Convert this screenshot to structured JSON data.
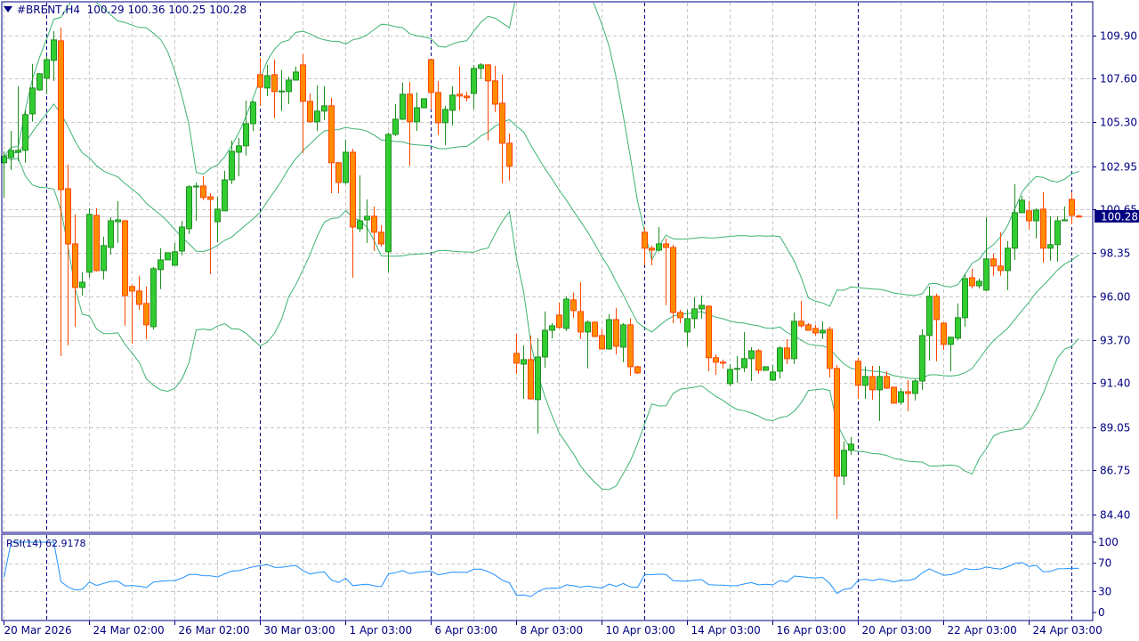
{
  "header": {
    "symbol": "#BRENT,H4",
    "open": "100.29",
    "high": "100.36",
    "low": "100.25",
    "close": "100.28"
  },
  "rsi_label": {
    "name": "RSI(14)",
    "value": "62.9178"
  },
  "current_price_label": "100.28",
  "colors": {
    "bull": "#32CD32",
    "bull_border": "#1F8F1F",
    "bear": "#FF8C00",
    "bear_border": "#FF4500",
    "bands": "#3CB371",
    "rsi": "#1E90FF",
    "axis": "#000080",
    "grid": "#C8C8C8"
  },
  "chart_data": [
    {
      "type": "candlestick",
      "title": "#BRENT,H4",
      "indicators": [
        "Bollinger Bands (20, 2)"
      ],
      "ylim": [
        83.45,
        111.7
      ],
      "y_ticks": [
        "109.90",
        "107.60",
        "105.30",
        "102.95",
        "100.65",
        "98.35",
        "96.00",
        "93.70",
        "91.40",
        "89.05",
        "86.75",
        "84.40"
      ],
      "x_ticks": [
        {
          "index": 0,
          "label": "20 Mar 2026"
        },
        {
          "index": 12,
          "label": "24 Mar 02:00"
        },
        {
          "index": 24,
          "label": "26 Mar 02:00"
        },
        {
          "index": 36,
          "label": "30 Mar 03:00"
        },
        {
          "index": 48,
          "label": "1 Apr 03:00"
        },
        {
          "index": 60,
          "label": "6 Apr 03:00"
        },
        {
          "index": 72,
          "label": "8 Apr 03:00"
        },
        {
          "index": 84,
          "label": "10 Apr 03:00"
        },
        {
          "index": 96,
          "label": "14 Apr 03:00"
        },
        {
          "index": 108,
          "label": "16 Apr 03:00"
        },
        {
          "index": 120,
          "label": "20 Apr 03:00"
        },
        {
          "index": 132,
          "label": "22 Apr 03:00"
        },
        {
          "index": 144,
          "label": "24 Apr 03:00"
        }
      ],
      "period_separators": [
        6,
        36,
        60,
        90,
        120,
        150
      ],
      "current_price": 100.28,
      "ohlc": [
        [
          103.13,
          103.74,
          101.28,
          103.46
        ],
        [
          103.41,
          104.83,
          102.75,
          103.79
        ],
        [
          103.69,
          107.2,
          103.22,
          103.79
        ],
        [
          103.79,
          105.92,
          103.13,
          105.69
        ],
        [
          105.73,
          108.39,
          105.31,
          107.11
        ],
        [
          107.01,
          107.91,
          106.97,
          107.87
        ],
        [
          107.63,
          108.81,
          106.78,
          108.62
        ],
        [
          108.58,
          110.14,
          107.49,
          109.67
        ],
        [
          109.62,
          110.33,
          92.84,
          101.7
        ],
        [
          101.75,
          103.03,
          93.41,
          98.81
        ],
        [
          98.81,
          100.38,
          94.4,
          96.49
        ],
        [
          96.49,
          97.3,
          96.06,
          96.77
        ],
        [
          97.3,
          100.71,
          97.01,
          100.38
        ],
        [
          100.33,
          100.71,
          97.34,
          97.39
        ],
        [
          97.39,
          99.19,
          96.92,
          98.72
        ],
        [
          98.62,
          100.23,
          98.24,
          100.04
        ],
        [
          99.99,
          101.09,
          98.86,
          100.09
        ],
        [
          100.04,
          100.09,
          94.45,
          96.06
        ],
        [
          96.54,
          96.63,
          93.5,
          96.3
        ],
        [
          96.3,
          97.11,
          95.3,
          95.59
        ],
        [
          95.64,
          96.54,
          93.74,
          94.5
        ],
        [
          94.4,
          97.58,
          94.26,
          97.49
        ],
        [
          97.44,
          98.58,
          96.4,
          97.96
        ],
        [
          97.96,
          98.34,
          97.96,
          98.34
        ],
        [
          97.67,
          98.86,
          97.67,
          98.39
        ],
        [
          98.43,
          100.04,
          98.2,
          99.71
        ],
        [
          99.62,
          101.94,
          99.33,
          101.85
        ],
        [
          101.85,
          102.08,
          100.04,
          101.89
        ],
        [
          101.89,
          102.41,
          101.14,
          101.28
        ],
        [
          101.32,
          101.51,
          97.2,
          101.18
        ],
        [
          99.99,
          101.32,
          98.91,
          100.66
        ],
        [
          100.57,
          102.7,
          100.57,
          102.22
        ],
        [
          102.22,
          104.31,
          101.99,
          103.74
        ],
        [
          103.69,
          104.45,
          102.41,
          104.03
        ],
        [
          104.03,
          106.44,
          103.51,
          105.21
        ],
        [
          105.21,
          106.44,
          104.83,
          106.35
        ],
        [
          107.82,
          108.72,
          106.16,
          107.15
        ],
        [
          107.11,
          108.34,
          106.68,
          107.77
        ],
        [
          107.82,
          108.62,
          105.5,
          106.92
        ],
        [
          106.92,
          108.06,
          105.88,
          106.95
        ],
        [
          106.92,
          107.72,
          106.25,
          107.53
        ],
        [
          107.53,
          108.25,
          107.53,
          107.96
        ],
        [
          108.34,
          108.91,
          103.65,
          106.4
        ],
        [
          106.4,
          106.82,
          105.31,
          105.31
        ],
        [
          105.31,
          107.25,
          104.83,
          105.88
        ],
        [
          105.88,
          107.2,
          105.4,
          106.16
        ],
        [
          106.16,
          106.59,
          101.51,
          103.13
        ],
        [
          103.13,
          103.17,
          101.51,
          102.08
        ],
        [
          102.08,
          104.36,
          101.99,
          103.69
        ],
        [
          103.69,
          103.88,
          97.01,
          99.71
        ],
        [
          99.62,
          102.46,
          99.43,
          100.04
        ],
        [
          100.09,
          101.18,
          98.86,
          100.28
        ],
        [
          100.28,
          100.8,
          98.43,
          99.43
        ],
        [
          99.43,
          99.81,
          98.67,
          98.81
        ],
        [
          98.39,
          104.74,
          97.3,
          104.64
        ],
        [
          104.64,
          106.25,
          104.55,
          105.45
        ],
        [
          105.45,
          107.39,
          105.4,
          106.78
        ],
        [
          106.78,
          107.44,
          102.98,
          105.31
        ],
        [
          105.31,
          106.87,
          104.83,
          106.06
        ],
        [
          106.06,
          106.54,
          106.06,
          106.54
        ],
        [
          108.62,
          108.62,
          105.97,
          106.87
        ],
        [
          106.87,
          107.49,
          104.6,
          105.26
        ],
        [
          105.26,
          106.16,
          104.07,
          105.97
        ],
        [
          105.92,
          107.2,
          105.12,
          106.73
        ],
        [
          106.78,
          108.25,
          105.92,
          106.68
        ],
        [
          106.68,
          106.92,
          106.4,
          106.59
        ],
        [
          106.82,
          108.34,
          105.97,
          108.15
        ],
        [
          108.15,
          108.43,
          107.58,
          108.34
        ],
        [
          108.34,
          108.39,
          104.31,
          107.49
        ],
        [
          107.49,
          108.29,
          105.83,
          106.25
        ],
        [
          106.3,
          107.82,
          102.04,
          104.17
        ],
        [
          104.17,
          104.69,
          102.18,
          102.94
        ],
        [
          92.98,
          94.03,
          91.89,
          92.46
        ],
        [
          92.41,
          93.41,
          90.56,
          92.65
        ],
        [
          92.65,
          93.93,
          90.52,
          90.56
        ],
        [
          90.52,
          93.79,
          88.72,
          92.79
        ],
        [
          92.79,
          95.21,
          92.22,
          94.21
        ],
        [
          94.21,
          94.59,
          93.79,
          94.45
        ],
        [
          95.02,
          95.68,
          94.31,
          94.36
        ],
        [
          94.31,
          96.02,
          94.17,
          95.87
        ],
        [
          95.83,
          96.21,
          94.88,
          95.26
        ],
        [
          95.21,
          96.77,
          93.74,
          94.12
        ],
        [
          94.12,
          94.74,
          92.18,
          94.64
        ],
        [
          94.64,
          94.69,
          93.84,
          93.88
        ],
        [
          93.93,
          94.26,
          93.17,
          93.22
        ],
        [
          93.22,
          95.07,
          93.17,
          94.78
        ],
        [
          94.78,
          95.4,
          92.93,
          93.36
        ],
        [
          93.31,
          94.59,
          92.51,
          94.5
        ],
        [
          94.5,
          94.83,
          91.8,
          92.27
        ],
        [
          92.27,
          92.32,
          91.89,
          91.94
        ],
        [
          99.43,
          99.71,
          97.67,
          98.58
        ],
        [
          98.58,
          98.72,
          97.67,
          98.48
        ],
        [
          98.48,
          99.71,
          98.39,
          98.81
        ],
        [
          98.81,
          99.1,
          95.54,
          98.62
        ],
        [
          98.62,
          98.77,
          94.59,
          95.16
        ],
        [
          95.16,
          95.3,
          94.59,
          94.88
        ],
        [
          94.12,
          95.3,
          93.36,
          94.83
        ],
        [
          94.83,
          95.97,
          94.31,
          95.35
        ],
        [
          95.35,
          96.06,
          94.83,
          95.54
        ],
        [
          95.49,
          95.54,
          92.03,
          92.75
        ],
        [
          92.75,
          92.93,
          91.84,
          92.51
        ],
        [
          92.51,
          92.65,
          92.18,
          92.46
        ],
        [
          91.37,
          92.41,
          91.23,
          92.13
        ],
        [
          92.18,
          92.84,
          91.42,
          92.18
        ],
        [
          92.22,
          94.12,
          91.99,
          92.7
        ],
        [
          92.7,
          93.31,
          91.51,
          93.12
        ],
        [
          93.12,
          93.22,
          91.89,
          92.08
        ],
        [
          92.08,
          92.27,
          92.08,
          92.27
        ],
        [
          91.56,
          92.37,
          91.51,
          91.99
        ],
        [
          92.03,
          93.36,
          91.65,
          93.27
        ],
        [
          93.27,
          93.74,
          92.41,
          92.7
        ],
        [
          92.7,
          95.16,
          92.41,
          94.69
        ],
        [
          94.69,
          95.78,
          94.36,
          94.45
        ],
        [
          94.5,
          94.59,
          94.21,
          94.21
        ],
        [
          94.31,
          94.5,
          93.93,
          94.07
        ],
        [
          94.07,
          94.69,
          93.74,
          94.21
        ],
        [
          94.26,
          94.4,
          91.7,
          92.18
        ],
        [
          92.18,
          92.37,
          84.17,
          86.44
        ],
        [
          86.44,
          88.29,
          85.97,
          87.82
        ],
        [
          87.82,
          88.53,
          87.58,
          88.15
        ],
        [
          92.56,
          92.75,
          90.56,
          91.28
        ],
        [
          91.28,
          92.27,
          90.56,
          91.75
        ],
        [
          91.75,
          92.32,
          90.52,
          91.04
        ],
        [
          91.04,
          92.32,
          89.38,
          91.75
        ],
        [
          91.75,
          92.03,
          91.09,
          91.13
        ],
        [
          91.18,
          91.18,
          90.33,
          90.33
        ],
        [
          90.38,
          91.13,
          90.24,
          90.94
        ],
        [
          90.94,
          91.56,
          89.9,
          90.85
        ],
        [
          90.85,
          91.61,
          90.47,
          91.51
        ],
        [
          91.51,
          94.26,
          91.04,
          93.93
        ],
        [
          93.93,
          96.54,
          92.6,
          96.02
        ],
        [
          96.02,
          96.16,
          92.56,
          94.78
        ],
        [
          94.59,
          94.64,
          93.17,
          93.46
        ],
        [
          93.46,
          93.88,
          92.03,
          93.84
        ],
        [
          93.79,
          95.64,
          93.69,
          94.88
        ],
        [
          94.88,
          97.2,
          94.4,
          96.96
        ],
        [
          97.01,
          97.49,
          96.44,
          96.58
        ],
        [
          96.58,
          96.96,
          96.44,
          96.82
        ],
        [
          96.35,
          100.23,
          96.3,
          98.01
        ],
        [
          98.01,
          98.29,
          97.11,
          97.63
        ],
        [
          97.63,
          99.43,
          97.11,
          97.39
        ],
        [
          97.39,
          98.95,
          96.35,
          98.58
        ],
        [
          98.58,
          101.99,
          97.96,
          100.47
        ],
        [
          100.47,
          101.37,
          100.47,
          101.14
        ],
        [
          100.57,
          101.09,
          99.57,
          100.04
        ],
        [
          100.04,
          100.71,
          99.1,
          100.61
        ],
        [
          100.66,
          101.56,
          97.82,
          98.58
        ],
        [
          98.58,
          100.28,
          97.91,
          98.77
        ],
        [
          98.77,
          100.28,
          97.86,
          100.04
        ],
        [
          100.04,
          100.8,
          100.04,
          100.09
        ],
        [
          101.18,
          101.56,
          99.85,
          100.33
        ],
        [
          100.29,
          100.36,
          100.25,
          100.28
        ]
      ]
    },
    {
      "type": "line",
      "title": "RSI(14)",
      "ylim": [
        0,
        100
      ],
      "y_ticks": [
        "100",
        "70",
        "30",
        "0"
      ],
      "levels": [
        30,
        70
      ],
      "period": 14
    }
  ]
}
